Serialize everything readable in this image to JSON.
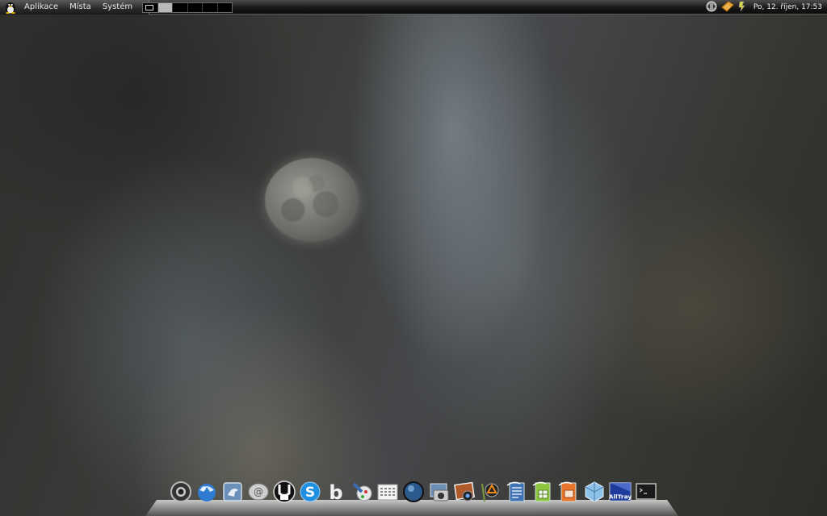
{
  "top_panel": {
    "menus": {
      "applications": "Aplikace",
      "places": "Místa",
      "system": "Systém"
    },
    "workspaces": {
      "count": 6,
      "active_index": 1
    },
    "clock": "Po, 12. říjen, 17:53",
    "tray_icons": [
      "network-icon",
      "keyboard-layout-icon",
      "power-icon"
    ]
  },
  "dock": {
    "icons": [
      "chromium-icon",
      "blue-sphere-icon",
      "pidgin-icon",
      "email-icon",
      "ubuntu-one-icon",
      "skype-icon",
      "bibletime-icon",
      "tools-icon",
      "calendar-icon",
      "globe-icon",
      "photo-camera-icon",
      "photo-viewer-icon",
      "graphics-editor-icon",
      "writer-document-icon",
      "spreadsheet-icon",
      "presentation-icon",
      "virtualbox-icon",
      "alltray-icon",
      "terminal-icon"
    ],
    "alltray_label": "AllTray"
  },
  "colors": {
    "panel": "#1a1a1a",
    "panel_text": "#e6e6e6",
    "dock_shelf": "#9a9a9a"
  }
}
